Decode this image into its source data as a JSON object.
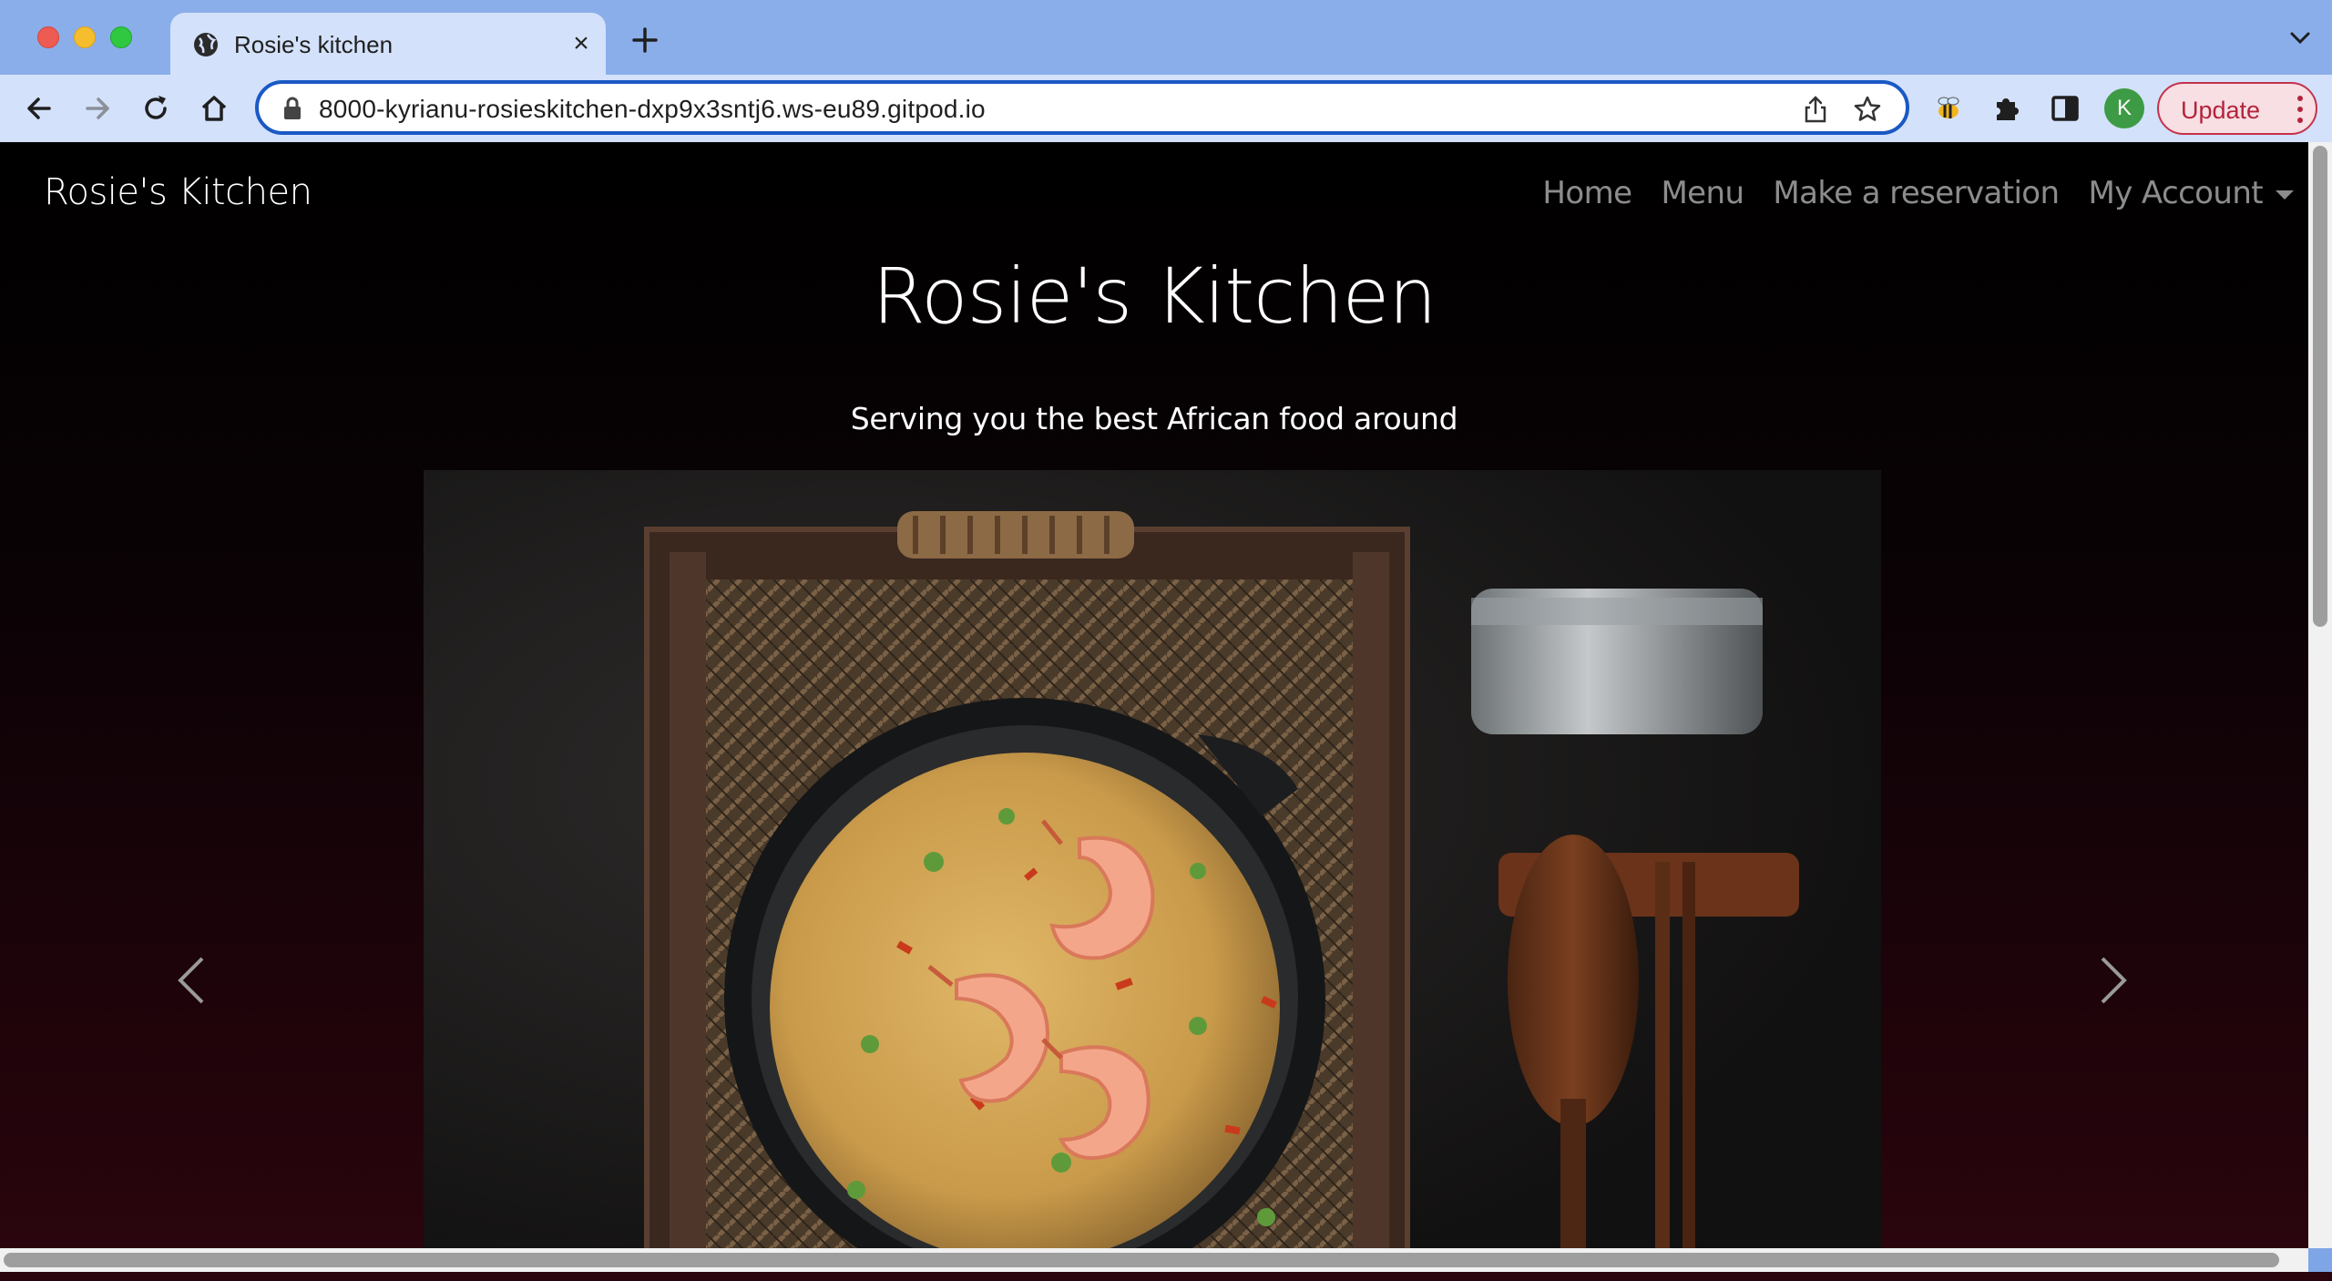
{
  "browser": {
    "tab": {
      "title": "Rosie's kitchen",
      "icon": "globe-icon"
    },
    "url": "8000-kyrianu-rosieskitchen-dxp9x3sntj6.ws-eu89.gitpod.io",
    "profile_initial": "K",
    "update_label": "Update",
    "colors": {
      "frame": "#8aaee9",
      "toolbar": "#d3e1fa",
      "focus": "#1a59c5",
      "update": "#b3243a"
    }
  },
  "site": {
    "brand": "Rosie's Kitchen",
    "nav": [
      "Home",
      "Menu",
      "Make a reservation",
      "My Account"
    ],
    "hero": {
      "title": "Rosie's Kitchen",
      "subtitle": "Serving you the best African food around"
    },
    "carousel": {
      "image": "jollof-rice-with-shrimp-image"
    },
    "colors": {
      "background_top": "#000000",
      "background_bottom": "#2a050d",
      "text": "#ffffff"
    }
  }
}
